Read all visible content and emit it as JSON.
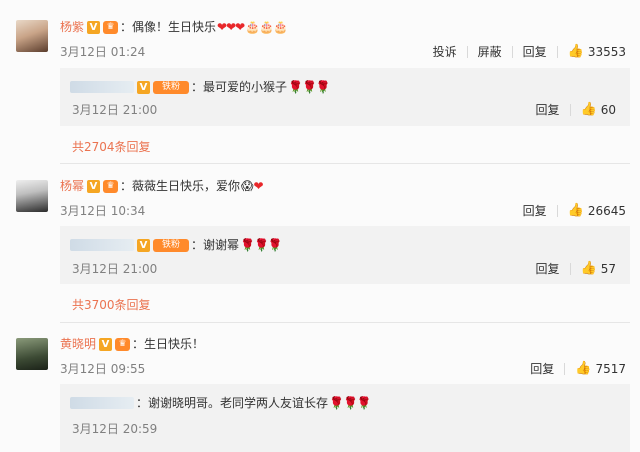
{
  "comments": [
    {
      "name": "杨紫",
      "v": "V",
      "text": "：偶像！生日快乐",
      "hearts": "❤❤❤",
      "cakes": "🎂🎂🎂",
      "time": "3月12日 01:24",
      "report": "投诉",
      "block": "屏蔽",
      "reply_label": "回复",
      "likes": "33553",
      "reply": {
        "tag": "铁粉",
        "text": "：最可爱的小猴子",
        "roses": "🌹🌹🌹",
        "time": "3月12日 21:00",
        "reply_label": "回复",
        "likes": "60"
      },
      "more": "共2704条回复"
    },
    {
      "name": "杨幂",
      "v": "V",
      "text": "：薇薇生日快乐，爱你",
      "emoji": "😱",
      "heart": "❤",
      "time": "3月12日 10:34",
      "reply_label": "回复",
      "likes": "26645",
      "reply": {
        "tag": "铁粉",
        "text": "：谢谢幂",
        "roses": "🌹🌹🌹",
        "time": "3月12日 21:00",
        "reply_label": "回复",
        "likes": "57"
      },
      "more": "共3700条回复"
    },
    {
      "name": "黄晓明",
      "v": "V",
      "text": "：生日快乐！",
      "time": "3月12日 09:55",
      "reply_label": "回复",
      "likes": "7517",
      "reply": {
        "text": "：谢谢晓明哥。老同学两人友谊长存",
        "roses": "🌹🌹🌹",
        "time": "3月12日 20:59"
      }
    }
  ],
  "icons": {
    "thumb": "thumbs-up-icon",
    "vip": "crown-icon"
  }
}
